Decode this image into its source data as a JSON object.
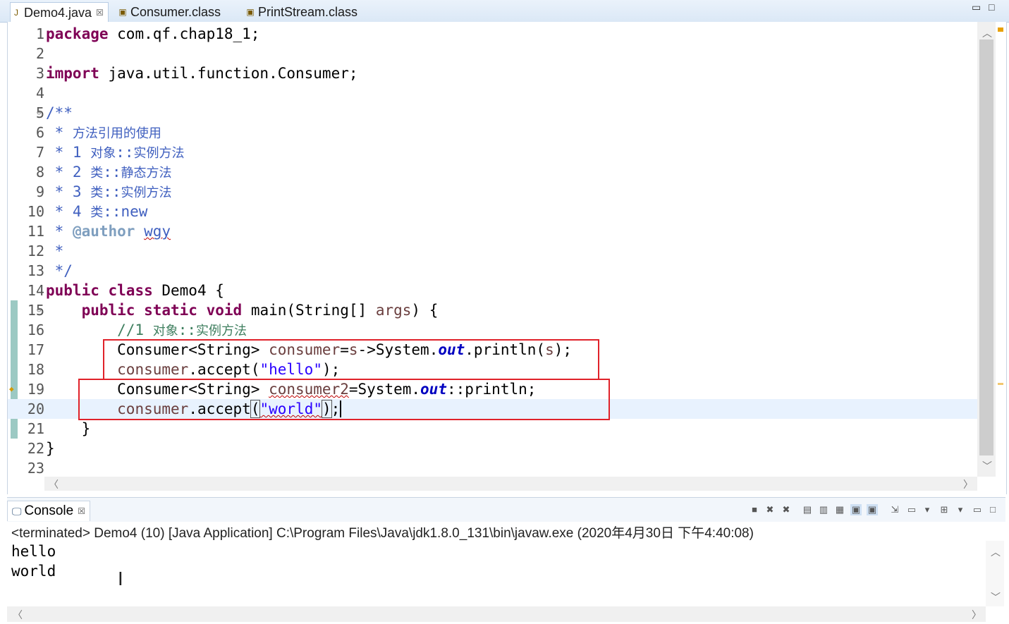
{
  "editor_tabs": [
    {
      "label": "Demo4.java",
      "active": true,
      "icon": "java-file-icon"
    },
    {
      "label": "Consumer.class",
      "active": false,
      "icon": "class-file-icon"
    },
    {
      "label": "PrintStream.class",
      "active": false,
      "icon": "class-file-icon"
    }
  ],
  "tab_close_glyph": "☒",
  "code_lines": [
    {
      "n": "1",
      "t": "package com.qf.chap18_1;"
    },
    {
      "n": "2",
      "t": ""
    },
    {
      "n": "3",
      "t": "import java.util.function.Consumer;"
    },
    {
      "n": "4",
      "t": ""
    },
    {
      "n": "5",
      "t": "/**"
    },
    {
      "n": "6",
      "t": " * 方法引用的使用"
    },
    {
      "n": "7",
      "t": " * 1 对象::实例方法"
    },
    {
      "n": "8",
      "t": " * 2 类::静态方法"
    },
    {
      "n": "9",
      "t": " * 3 类::实例方法"
    },
    {
      "n": "10",
      "t": " * 4 类::new"
    },
    {
      "n": "11",
      "t": " * @author wgy"
    },
    {
      "n": "12",
      "t": " *"
    },
    {
      "n": "13",
      "t": " */"
    },
    {
      "n": "14",
      "t": "public class Demo4 {"
    },
    {
      "n": "15",
      "t": "    public static void main(String[] args) {"
    },
    {
      "n": "16",
      "t": "        //1 对象::实例方法"
    },
    {
      "n": "17",
      "t": "        Consumer<String> consumer=s->System.out.println(s);"
    },
    {
      "n": "18",
      "t": "        consumer.accept(\"hello\");"
    },
    {
      "n": "19",
      "t": "        Consumer<String> consumer2=System.out::println;"
    },
    {
      "n": "20",
      "t": "        consumer.accept(\"world\");"
    },
    {
      "n": "21",
      "t": "    }"
    },
    {
      "n": "22",
      "t": "}"
    },
    {
      "n": "23",
      "t": ""
    }
  ],
  "console": {
    "tab_label": "Console",
    "status": "<terminated> Demo4 (10) [Java Application] C:\\Program Files\\Java\\jdk1.8.0_131\\bin\\javaw.exe (2020年4月30日 下午4:40:08)",
    "output": [
      "hello",
      "world"
    ]
  },
  "colors": {
    "keyword": "#7f0055",
    "comment": "#3f7f5f",
    "javadoc": "#3f5fbf",
    "string": "#2a00ff",
    "highlight_box": "#e0222a",
    "current_line": "#e8f2fe"
  }
}
